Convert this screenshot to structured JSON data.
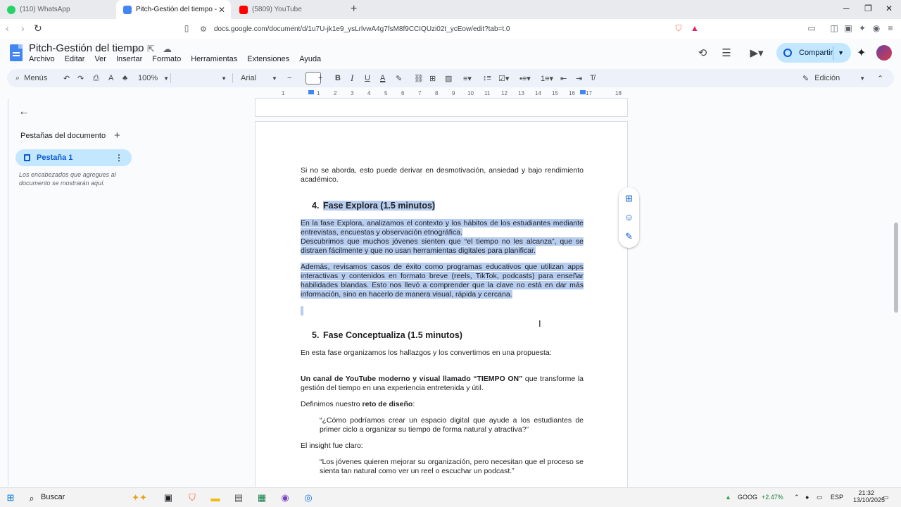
{
  "browser": {
    "tabs": [
      {
        "title": "(110) WhatsApp",
        "color": "#25d366"
      },
      {
        "title": "Pitch-Gestión del tiempo - Docu",
        "color": "#4285f4"
      },
      {
        "title": "(5809) YouTube",
        "color": "#ff0000"
      }
    ],
    "url": "docs.google.com/document/d/1u7U-jk1e9_ysLrlvwA4g7fsM8f9CCIQUzi02t_ycEow/edit?tab=t.0"
  },
  "docs": {
    "title": "Pitch-Gestión del tiempo",
    "menu": [
      "Archivo",
      "Editar",
      "Ver",
      "Insertar",
      "Formato",
      "Herramientas",
      "Extensiones",
      "Ayuda"
    ],
    "share_label": "Compartir"
  },
  "toolbar": {
    "menus_label": "Menús",
    "zoom": "100%",
    "font": "Arial",
    "mode": "Edición"
  },
  "ruler_ticks": [
    "1",
    "1",
    "2",
    "3",
    "4",
    "5",
    "6",
    "7",
    "8",
    "9",
    "10",
    "11",
    "12",
    "13",
    "14",
    "15",
    "16",
    "17",
    "18"
  ],
  "sidebar": {
    "title": "Pestañas del documento",
    "tab_label": "Pestaña 1",
    "hint": "Los encabezados que agregues al documento se mostrarán aquí."
  },
  "document": {
    "p0": "Si no se aborda, esto puede derivar en desmotivación, ansiedad y bajo rendimiento académico.",
    "h4_num": "4.",
    "h4": "Fase Explora (1.5 minutos)",
    "p1": "En la fase Explora, analizamos el contexto y los hábitos de los estudiantes mediante entrevistas, encuestas y observación etnográfica.",
    "p2": "Descubrimos que muchos jóvenes sienten que “el tiempo no les alcanza”, que se distraen fácilmente y que no usan herramientas digitales para planificar.",
    "p3": "Además, revisamos casos de éxito como programas educativos que utilizan apps interactivas y contenidos en formato breve (reels, TikTok, podcasts) para enseñar habilidades blandas. Esto nos llevó a comprender que la clave no está en dar más información, sino en hacerlo de manera visual, rápida y cercana.",
    "h5_num": "5.",
    "h5": "Fase Conceptualiza (1.5 minutos)",
    "p4": "En esta fase organizamos los hallazgos y los convertimos en una propuesta:",
    "p5_bold": "Un canal de YouTube moderno y visual llamado “TIEMPO ON”",
    "p5_rest": " que transforme la gestión del tiempo en una experiencia entretenida y útil.",
    "p6_pre": "Definimos nuestro ",
    "p6_bold": "reto de diseño",
    "p6_post": ":",
    "q1": "“¿Cómo podríamos crear un espacio digital que ayude a los estudiantes de primer ciclo a organizar su tiempo de forma natural y atractiva?”",
    "p7": "El insight fue claro:",
    "q2": "“Los jóvenes quieren mejorar su organización, pero necesitan que el proceso se sienta tan natural como ver un reel o escuchar un podcast.”"
  },
  "taskbar": {
    "search": "Buscar",
    "stock": "GOOG",
    "stock_change": "+2.47%",
    "lang": "ESP",
    "time": "21:32",
    "date": "13/10/2025"
  }
}
